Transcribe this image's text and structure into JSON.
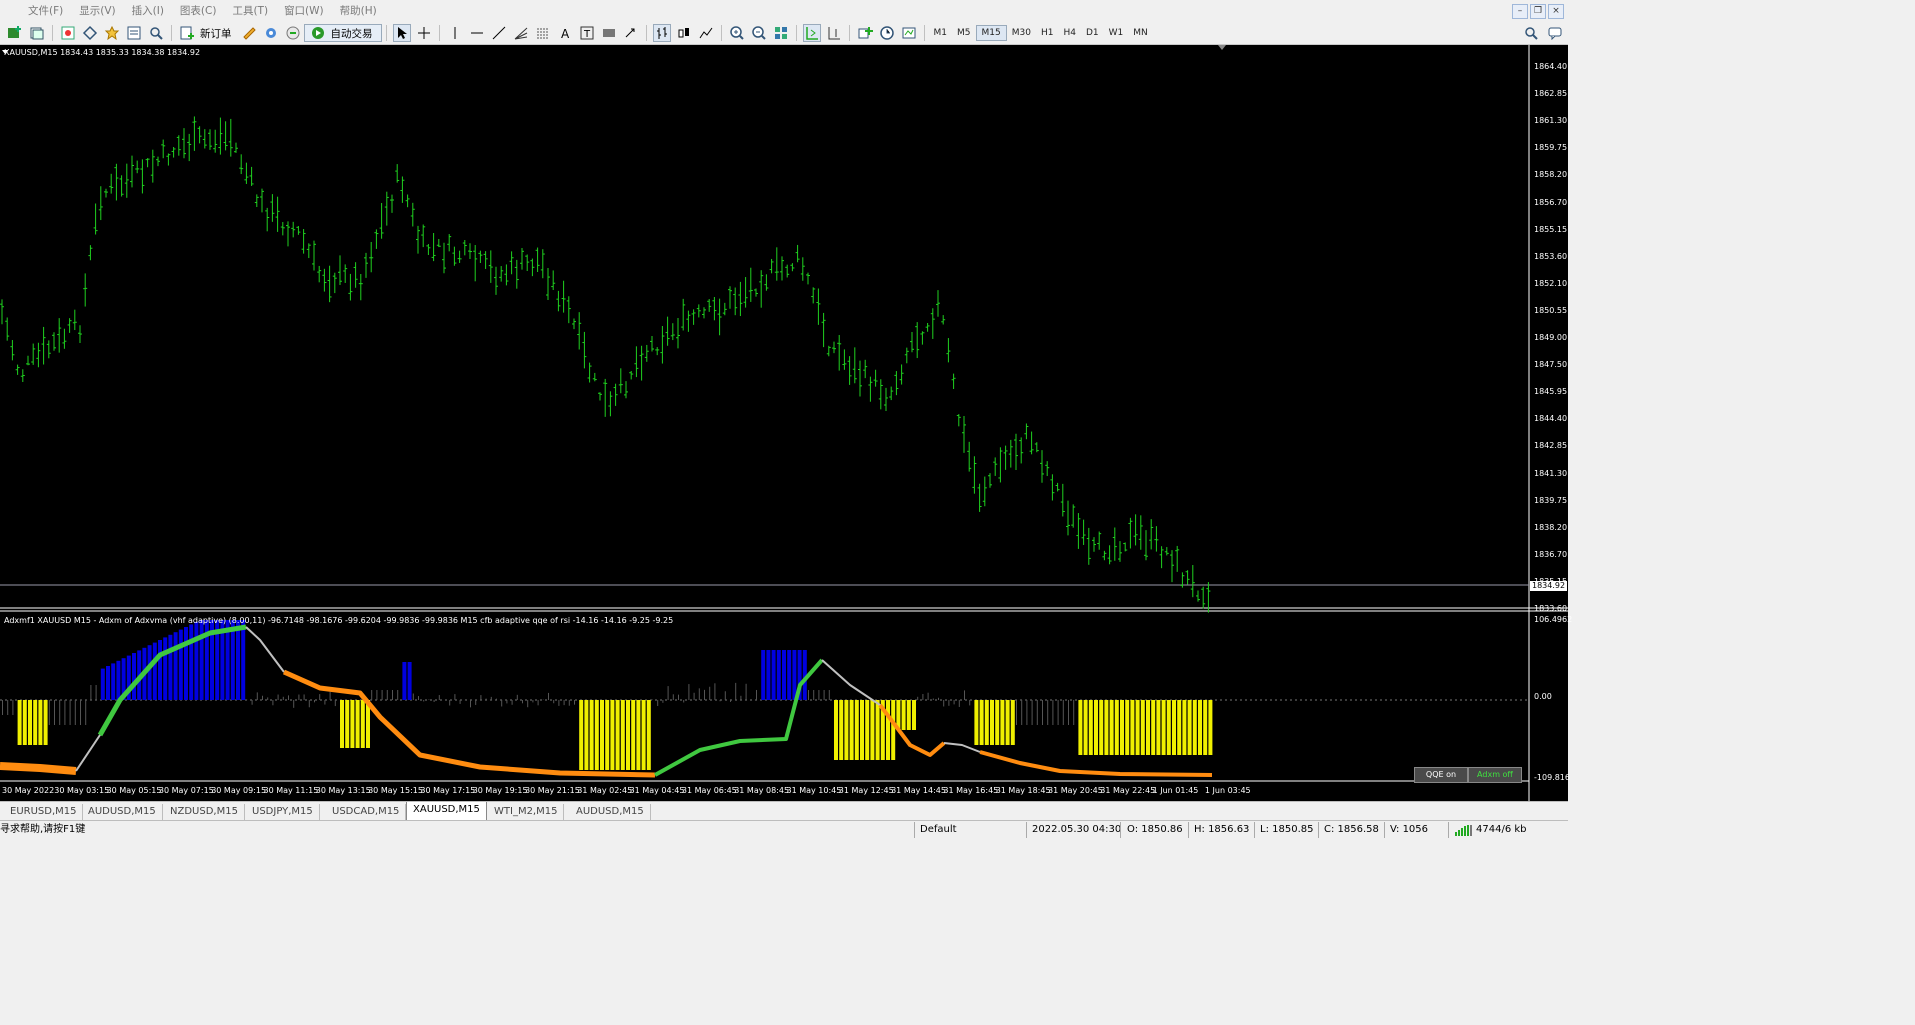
{
  "menu": [
    "文件(F)",
    "显示(V)",
    "插入(I)",
    "图表(C)",
    "工具(T)",
    "窗口(W)",
    "帮助(H)"
  ],
  "window_controls": [
    "minimize",
    "restore",
    "close"
  ],
  "toolbar": {
    "new_order_label": "新订单",
    "auto_trade_label": "自动交易",
    "timeframes": [
      "M1",
      "M5",
      "M15",
      "M30",
      "H1",
      "H4",
      "D1",
      "W1",
      "MN"
    ],
    "active_timeframe": "M15"
  },
  "chart": {
    "price_title": "XAUUSD,M15  1834.43 1835.33 1834.38 1834.92",
    "price_axis": [
      "1864.40",
      "1862.85",
      "1861.30",
      "1859.75",
      "1858.20",
      "1856.70",
      "1855.15",
      "1853.60",
      "1852.10",
      "1850.55",
      "1849.00",
      "1847.50",
      "1845.95",
      "1844.40",
      "1842.85",
      "1841.30",
      "1839.75",
      "1838.20",
      "1836.70",
      "1835.15",
      "1833.60"
    ],
    "current_price": "1834.92",
    "indicator_title": "Adxmf1 XAUUSD M15 - Adxm of Adxvma (vhf adaptive) (8.00,11) -96.7148 -98.1676 -99.6204 -99.9836 -99.9836  M15  cfb adaptive qqe of rsi -14.16 -14.16 -9.25 -9.25",
    "indicator_axis": [
      "106.4962",
      "0.00",
      "-109.816"
    ],
    "time_axis": [
      "30 May 2022",
      "30 May 03:15",
      "30 May 05:15",
      "30 May 07:15",
      "30 May 09:15",
      "30 May 11:15",
      "30 May 13:15",
      "30 May 15:15",
      "30 May 17:15",
      "30 May 19:15",
      "30 May 21:15",
      "31 May 02:45",
      "31 May 04:45",
      "31 May 06:45",
      "31 May 08:45",
      "31 May 10:45",
      "31 May 12:45",
      "31 May 14:45",
      "31 May 16:45",
      "31 May 18:45",
      "31 May 20:45",
      "31 May 22:45",
      "1 Jun 01:45",
      "1 Jun 03:45"
    ],
    "buttons": {
      "qqe": "QQE on",
      "adxm": "Adxm off"
    },
    "colors": {
      "bull_candle": "#1fd11f",
      "histogram_up": "#0000e0",
      "histogram_down": "#f0f000",
      "qqe_green": "#40c840",
      "qqe_orange": "#ff8c10",
      "qqe_gray": "#c0c0c0",
      "adxm_off_text": "#40e040"
    }
  },
  "tabs": [
    "EURUSD,M15",
    "AUDUSD,M15",
    "NZDUSD,M15",
    "USDJPY,M15",
    "USDCAD,M15",
    "XAUUSD,M15",
    "WTI_M2,M15",
    "AUDUSD,M15"
  ],
  "active_tab": "XAUUSD,M15",
  "status": {
    "help": "寻求帮助,请按F1键",
    "profile": "Default",
    "datetime": "2022.05.30 04:30",
    "open": "O: 1850.86",
    "high": "H: 1856.63",
    "low": "L: 1850.85",
    "close": "C: 1856.58",
    "volume": "V: 1056",
    "traffic": "4744/6 kb"
  }
}
